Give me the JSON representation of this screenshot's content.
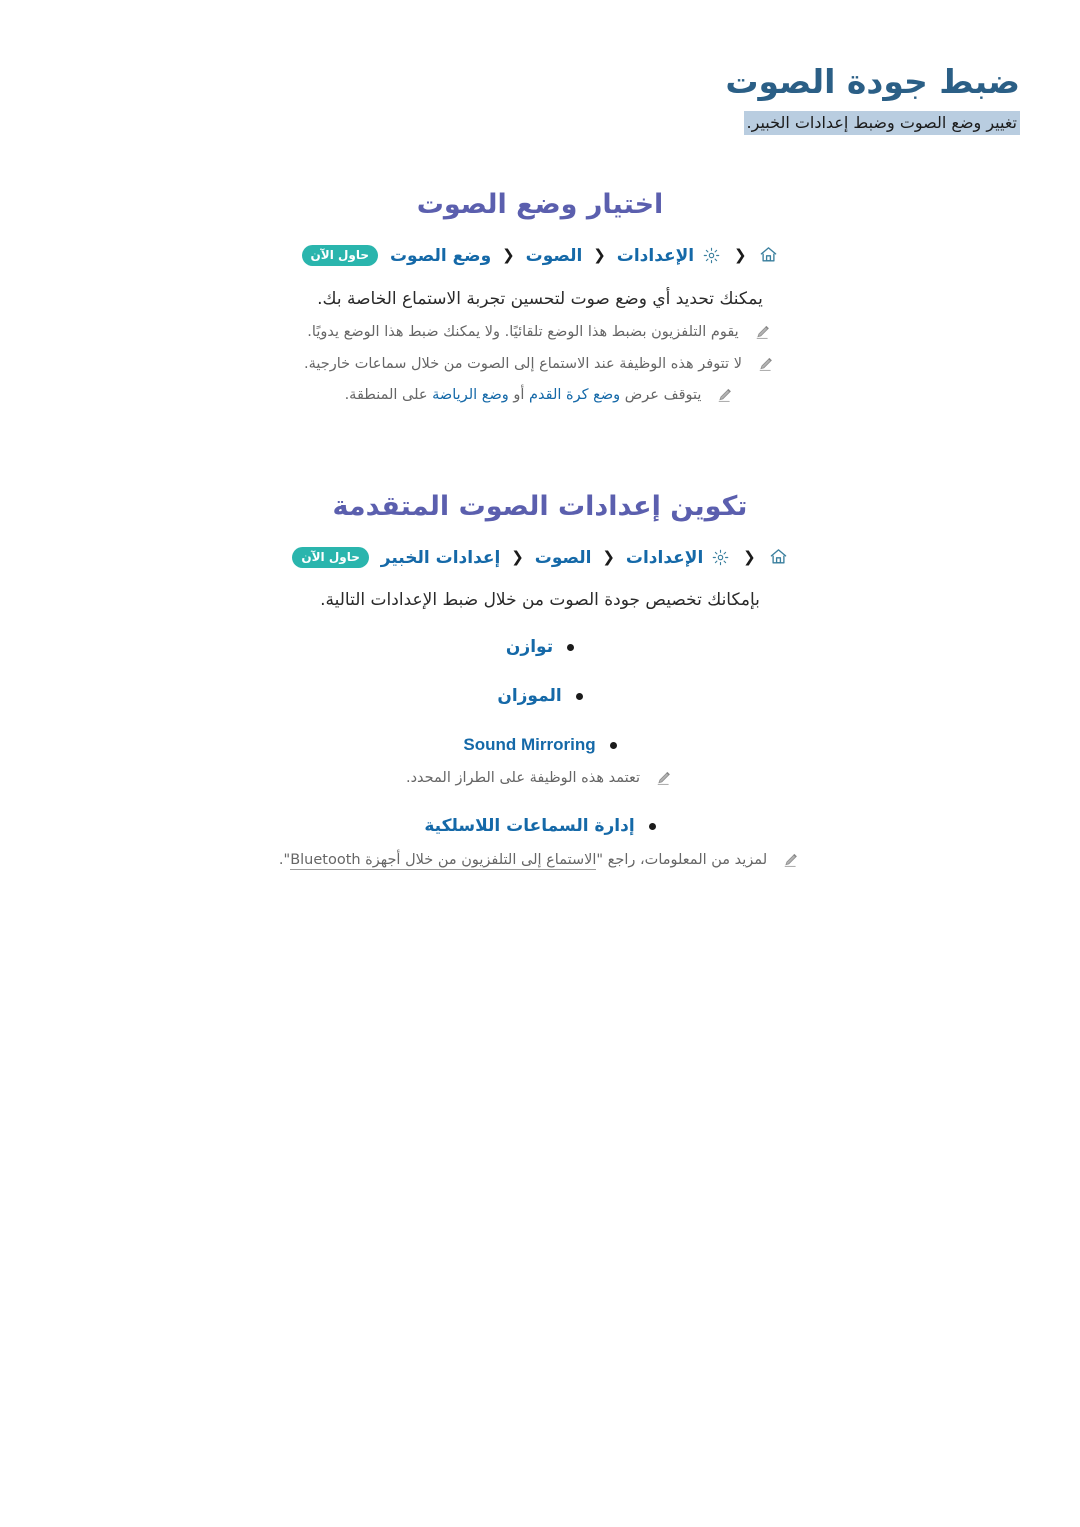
{
  "header": {
    "title": "ضبط جودة الصوت",
    "subtitle": "تغيير وضع الصوت وضبط إعدادات الخبير."
  },
  "colors": {
    "title_blue": "#2b5f86",
    "heading_purple": "#5b5fae",
    "link_blue": "#1569a8",
    "badge_teal": "#2ab5ad",
    "subtitle_highlight": "#b9cde0",
    "note_gray": "#666666",
    "body_text": "#2a2a2a"
  },
  "icons": {
    "home": "home-icon",
    "gear": "gear-icon",
    "chevron": "❮",
    "pencil": "pencil-note-icon"
  },
  "sections": [
    {
      "heading": "اختيار وضع الصوت",
      "navpath": {
        "home_icon": "home-icon",
        "gear_icon": "gear-icon",
        "crumbs": [
          "الإعدادات",
          "الصوت",
          "وضع الصوت"
        ],
        "badge": "حاول الآن"
      },
      "body": "يمكنك تحديد أي وضع صوت لتحسين تجربة الاستماع الخاصة بك.",
      "notes": [
        {
          "parts": [
            {
              "text": "يقوم التلفزيون بضبط هذا الوضع تلقائيًا. ولا يمكنك ضبط هذا الوضع يدويًا.",
              "style": "plain"
            }
          ]
        },
        {
          "parts": [
            {
              "text": "لا تتوفر هذه الوظيفة عند الاستماع إلى الصوت من خلال سماعات خارجية.",
              "style": "plain"
            }
          ]
        },
        {
          "parts": [
            {
              "text": "يتوقف عرض ",
              "style": "plain"
            },
            {
              "text": "وضع كرة القدم",
              "style": "highlight"
            },
            {
              "text": " أو ",
              "style": "plain"
            },
            {
              "text": "وضع الرياضة",
              "style": "highlight"
            },
            {
              "text": " على المنطقة.",
              "style": "plain"
            }
          ]
        }
      ]
    },
    {
      "heading": "تكوين إعدادات الصوت المتقدمة",
      "navpath": {
        "home_icon": "home-icon",
        "gear_icon": "gear-icon",
        "crumbs": [
          "الإعدادات",
          "الصوت",
          "إعدادات الخبير"
        ],
        "badge": "حاول الآن"
      },
      "body": "بإمكانك تخصيص جودة الصوت من خلال ضبط الإعدادات التالية.",
      "bullets": [
        {
          "label": "توازن",
          "script": "arabic",
          "note": null
        },
        {
          "label": "الموزان",
          "script": "arabic",
          "note": null
        },
        {
          "label": "Sound Mirroring",
          "script": "latin",
          "note": "تعتمد هذه الوظيفة على الطراز المحدد."
        },
        {
          "label": "إدارة السماعات اللاسلكية",
          "script": "arabic",
          "note_parts": [
            {
              "text": "لمزيد من المعلومات، راجع \"",
              "style": "plain"
            },
            {
              "text": "الاستماع إلى التلفزيون من خلال أجهزة Bluetooth",
              "style": "xref"
            },
            {
              "text": "\".",
              "style": "plain"
            }
          ]
        }
      ]
    }
  ]
}
